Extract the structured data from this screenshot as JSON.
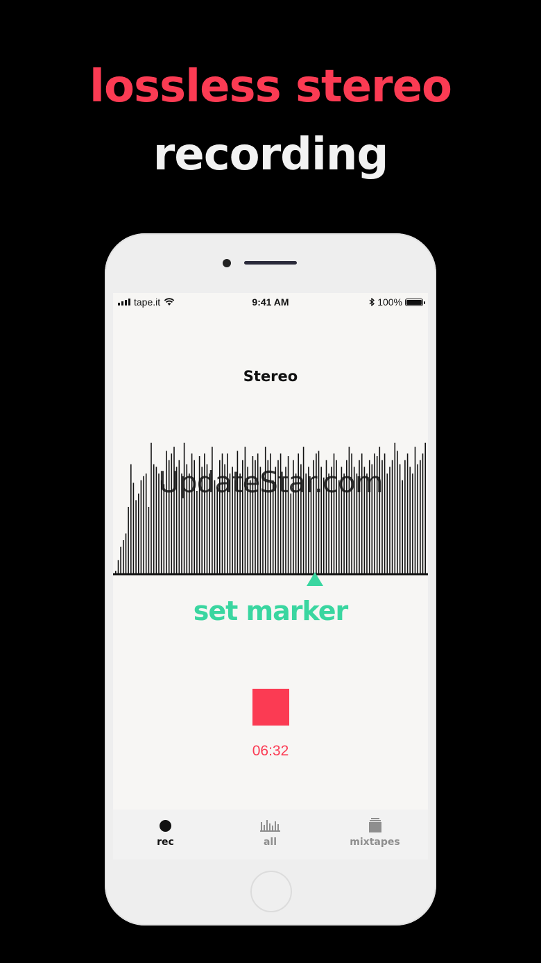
{
  "headline": {
    "line1": "lossless stereo",
    "line2": "recording"
  },
  "colors": {
    "accent_red": "#fb3b53",
    "accent_green": "#3ad6a0",
    "headline_white": "#f2f2f2",
    "tab_active": "#111111",
    "tab_inactive": "#8e8e8e"
  },
  "status_bar": {
    "carrier": "tape.it",
    "time": "9:41 AM",
    "battery": "100%",
    "icons": [
      "signal-icon",
      "wifi-icon",
      "bluetooth-icon",
      "battery-icon"
    ]
  },
  "recording": {
    "title": "Stereo",
    "watermark": "UpdateStar.com",
    "marker_label": "set marker",
    "elapsed": "06:32",
    "waveform_levels": [
      0.02,
      0.1,
      0.2,
      0.25,
      0.3,
      0.5,
      0.82,
      0.68,
      0.55,
      0.6,
      0.7,
      0.73,
      0.75,
      0.5,
      0.98,
      0.82,
      0.8,
      0.75,
      0.7,
      0.67,
      0.92,
      0.85,
      0.9,
      0.95,
      0.8,
      0.85,
      0.75,
      0.98,
      0.82,
      0.75,
      0.9,
      0.85,
      0.62,
      0.88,
      0.8,
      0.9,
      0.82,
      0.75,
      0.95,
      0.7,
      0.65,
      0.85,
      0.9,
      0.82,
      0.9,
      0.75,
      0.8,
      0.7,
      0.92,
      0.75,
      0.85,
      0.95,
      0.8,
      0.7,
      0.88,
      0.85,
      0.9,
      0.8,
      0.75,
      0.95,
      0.85,
      0.9,
      0.7,
      0.8,
      0.85,
      0.9,
      0.72,
      0.8,
      0.88,
      0.6,
      0.85,
      0.75,
      0.9,
      0.82,
      0.95,
      0.75,
      0.8,
      0.7,
      0.85,
      0.9,
      0.92,
      0.8,
      0.72,
      0.85,
      0.75,
      0.8,
      0.9,
      0.85,
      0.7,
      0.8,
      0.75,
      0.85,
      0.95,
      0.9,
      0.8,
      0.75,
      0.85,
      0.9,
      0.8,
      0.75,
      0.85,
      0.82,
      0.9,
      0.88,
      0.95,
      0.85,
      0.9,
      0.75,
      0.8,
      0.85,
      0.98,
      0.92,
      0.82,
      0.7,
      0.85,
      0.9,
      0.8,
      0.75,
      0.95,
      0.82,
      0.85,
      0.9,
      0.98
    ]
  },
  "tabs": [
    {
      "id": "rec",
      "label": "rec",
      "icon": "record-dot-icon",
      "active": true
    },
    {
      "id": "all",
      "label": "all",
      "icon": "bars-icon",
      "active": false
    },
    {
      "id": "mixtapes",
      "label": "mixtapes",
      "icon": "stack-icon",
      "active": false
    }
  ]
}
